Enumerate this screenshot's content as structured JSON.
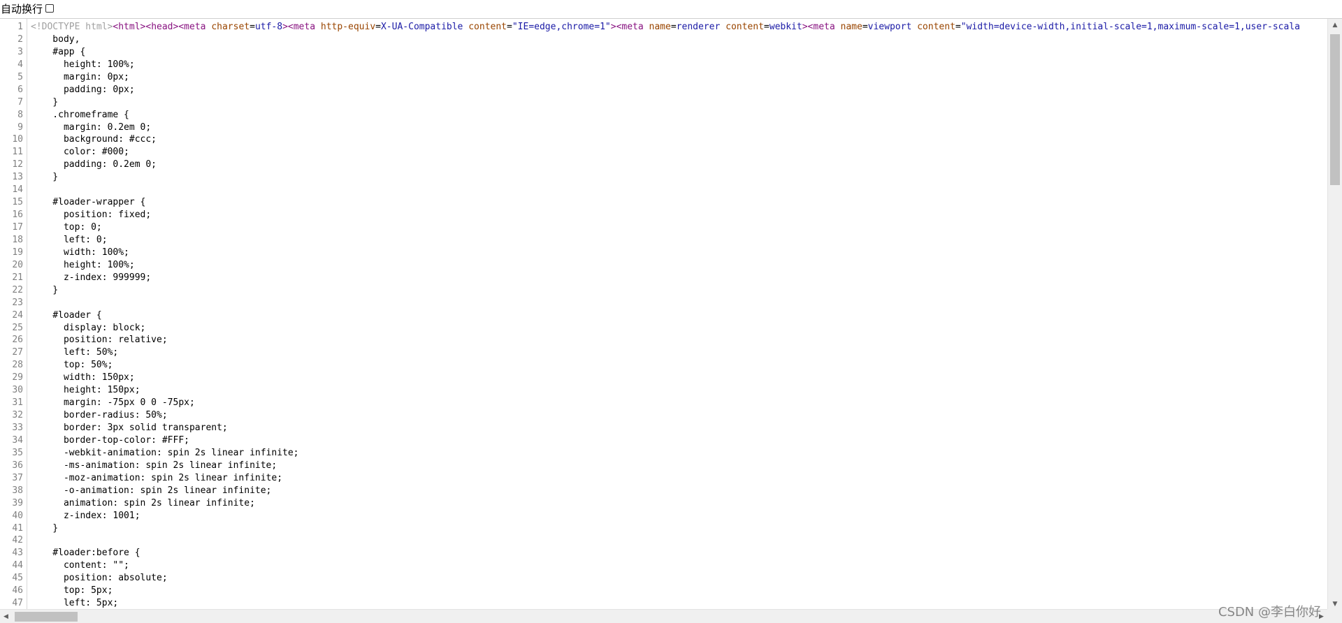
{
  "toolbar": {
    "wrap_label": "自动换行",
    "wrap_checked": false
  },
  "watermark": "CSDN @李白你好",
  "code_lines": [
    {
      "n": "1",
      "parts": [
        {
          "t": "<!DOCTYPE html>",
          "c": "doctype"
        },
        {
          "t": "<html>",
          "c": "tag"
        },
        {
          "t": "<head>",
          "c": "tag"
        },
        {
          "t": "<meta ",
          "c": "tag"
        },
        {
          "t": "charset",
          "c": "attr"
        },
        {
          "t": "=",
          "c": ""
        },
        {
          "t": "utf-8",
          "c": "val"
        },
        {
          "t": ">",
          "c": "tag"
        },
        {
          "t": "<meta ",
          "c": "tag"
        },
        {
          "t": "http-equiv",
          "c": "attr"
        },
        {
          "t": "=",
          "c": ""
        },
        {
          "t": "X-UA-Compatible",
          "c": "val"
        },
        {
          "t": " ",
          "c": ""
        },
        {
          "t": "content",
          "c": "attr"
        },
        {
          "t": "=",
          "c": ""
        },
        {
          "t": "\"IE=edge,chrome=1\"",
          "c": "val"
        },
        {
          "t": ">",
          "c": "tag"
        },
        {
          "t": "<meta ",
          "c": "tag"
        },
        {
          "t": "name",
          "c": "attr"
        },
        {
          "t": "=",
          "c": ""
        },
        {
          "t": "renderer",
          "c": "val"
        },
        {
          "t": " ",
          "c": ""
        },
        {
          "t": "content",
          "c": "attr"
        },
        {
          "t": "=",
          "c": ""
        },
        {
          "t": "webkit",
          "c": "val"
        },
        {
          "t": ">",
          "c": "tag"
        },
        {
          "t": "<meta ",
          "c": "tag"
        },
        {
          "t": "name",
          "c": "attr"
        },
        {
          "t": "=",
          "c": ""
        },
        {
          "t": "viewport",
          "c": "val"
        },
        {
          "t": " ",
          "c": ""
        },
        {
          "t": "content",
          "c": "attr"
        },
        {
          "t": "=",
          "c": ""
        },
        {
          "t": "\"width=device-width,initial-scale=1,maximum-scale=1,user-scala",
          "c": "val"
        }
      ]
    },
    {
      "n": "2",
      "parts": [
        {
          "t": "    body,",
          "c": ""
        }
      ]
    },
    {
      "n": "3",
      "parts": [
        {
          "t": "    #app {",
          "c": ""
        }
      ]
    },
    {
      "n": "4",
      "parts": [
        {
          "t": "      height: 100%;",
          "c": ""
        }
      ]
    },
    {
      "n": "5",
      "parts": [
        {
          "t": "      margin: 0px;",
          "c": ""
        }
      ]
    },
    {
      "n": "6",
      "parts": [
        {
          "t": "      padding: 0px;",
          "c": ""
        }
      ]
    },
    {
      "n": "7",
      "parts": [
        {
          "t": "    }",
          "c": ""
        }
      ]
    },
    {
      "n": "8",
      "parts": [
        {
          "t": "    .chromeframe {",
          "c": ""
        }
      ]
    },
    {
      "n": "9",
      "parts": [
        {
          "t": "      margin: 0.2em 0;",
          "c": ""
        }
      ]
    },
    {
      "n": "10",
      "parts": [
        {
          "t": "      background: #ccc;",
          "c": ""
        }
      ]
    },
    {
      "n": "11",
      "parts": [
        {
          "t": "      color: #000;",
          "c": ""
        }
      ]
    },
    {
      "n": "12",
      "parts": [
        {
          "t": "      padding: 0.2em 0;",
          "c": ""
        }
      ]
    },
    {
      "n": "13",
      "parts": [
        {
          "t": "    }",
          "c": ""
        }
      ]
    },
    {
      "n": "14",
      "parts": [
        {
          "t": "",
          "c": ""
        }
      ]
    },
    {
      "n": "15",
      "parts": [
        {
          "t": "    #loader-wrapper {",
          "c": ""
        }
      ]
    },
    {
      "n": "16",
      "parts": [
        {
          "t": "      position: fixed;",
          "c": ""
        }
      ]
    },
    {
      "n": "17",
      "parts": [
        {
          "t": "      top: 0;",
          "c": ""
        }
      ]
    },
    {
      "n": "18",
      "parts": [
        {
          "t": "      left: 0;",
          "c": ""
        }
      ]
    },
    {
      "n": "19",
      "parts": [
        {
          "t": "      width: 100%;",
          "c": ""
        }
      ]
    },
    {
      "n": "20",
      "parts": [
        {
          "t": "      height: 100%;",
          "c": ""
        }
      ]
    },
    {
      "n": "21",
      "parts": [
        {
          "t": "      z-index: 999999;",
          "c": ""
        }
      ]
    },
    {
      "n": "22",
      "parts": [
        {
          "t": "    }",
          "c": ""
        }
      ]
    },
    {
      "n": "23",
      "parts": [
        {
          "t": "",
          "c": ""
        }
      ]
    },
    {
      "n": "24",
      "parts": [
        {
          "t": "    #loader {",
          "c": ""
        }
      ]
    },
    {
      "n": "25",
      "parts": [
        {
          "t": "      display: block;",
          "c": ""
        }
      ]
    },
    {
      "n": "26",
      "parts": [
        {
          "t": "      position: relative;",
          "c": ""
        }
      ]
    },
    {
      "n": "27",
      "parts": [
        {
          "t": "      left: 50%;",
          "c": ""
        }
      ]
    },
    {
      "n": "28",
      "parts": [
        {
          "t": "      top: 50%;",
          "c": ""
        }
      ]
    },
    {
      "n": "29",
      "parts": [
        {
          "t": "      width: 150px;",
          "c": ""
        }
      ]
    },
    {
      "n": "30",
      "parts": [
        {
          "t": "      height: 150px;",
          "c": ""
        }
      ]
    },
    {
      "n": "31",
      "parts": [
        {
          "t": "      margin: -75px 0 0 -75px;",
          "c": ""
        }
      ]
    },
    {
      "n": "32",
      "parts": [
        {
          "t": "      border-radius: 50%;",
          "c": ""
        }
      ]
    },
    {
      "n": "33",
      "parts": [
        {
          "t": "      border: 3px solid transparent;",
          "c": ""
        }
      ]
    },
    {
      "n": "34",
      "parts": [
        {
          "t": "      border-top-color: #FFF;",
          "c": ""
        }
      ]
    },
    {
      "n": "35",
      "parts": [
        {
          "t": "      -webkit-animation: spin 2s linear infinite;",
          "c": ""
        }
      ]
    },
    {
      "n": "36",
      "parts": [
        {
          "t": "      -ms-animation: spin 2s linear infinite;",
          "c": ""
        }
      ]
    },
    {
      "n": "37",
      "parts": [
        {
          "t": "      -moz-animation: spin 2s linear infinite;",
          "c": ""
        }
      ]
    },
    {
      "n": "38",
      "parts": [
        {
          "t": "      -o-animation: spin 2s linear infinite;",
          "c": ""
        }
      ]
    },
    {
      "n": "39",
      "parts": [
        {
          "t": "      animation: spin 2s linear infinite;",
          "c": ""
        }
      ]
    },
    {
      "n": "40",
      "parts": [
        {
          "t": "      z-index: 1001;",
          "c": ""
        }
      ]
    },
    {
      "n": "41",
      "parts": [
        {
          "t": "    }",
          "c": ""
        }
      ]
    },
    {
      "n": "42",
      "parts": [
        {
          "t": "",
          "c": ""
        }
      ]
    },
    {
      "n": "43",
      "parts": [
        {
          "t": "    #loader:before {",
          "c": ""
        }
      ]
    },
    {
      "n": "44",
      "parts": [
        {
          "t": "      content: \"\";",
          "c": ""
        }
      ]
    },
    {
      "n": "45",
      "parts": [
        {
          "t": "      position: absolute;",
          "c": ""
        }
      ]
    },
    {
      "n": "46",
      "parts": [
        {
          "t": "      top: 5px;",
          "c": ""
        }
      ]
    },
    {
      "n": "47",
      "parts": [
        {
          "t": "      left: 5px;",
          "c": ""
        }
      ]
    }
  ],
  "scrollbars": {
    "up_icon": "▲",
    "down_icon": "▼",
    "left_icon": "◀",
    "right_icon": "▶"
  }
}
